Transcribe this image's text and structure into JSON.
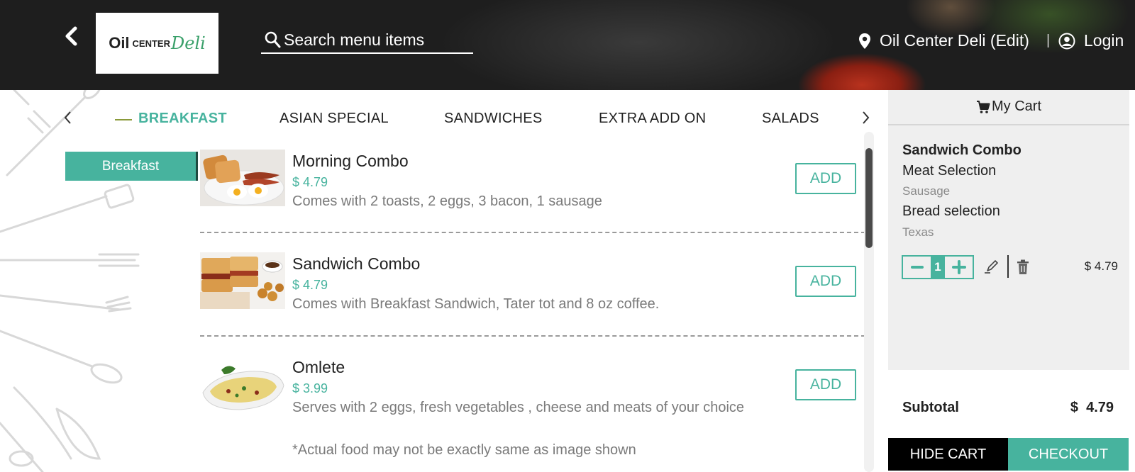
{
  "header": {
    "logo": {
      "word1": "Oil",
      "word2": "CENTER",
      "word3": "Deli"
    },
    "search": {
      "placeholder": "Search menu items"
    },
    "location": {
      "label": "Oil Center Deli (Edit)"
    },
    "separator": "|",
    "login": {
      "label": "Login"
    }
  },
  "tabs": [
    {
      "label": "BREAKFAST",
      "active": true
    },
    {
      "label": "ASIAN SPECIAL",
      "active": false
    },
    {
      "label": "SANDWICHES",
      "active": false
    },
    {
      "label": "EXTRA ADD ON",
      "active": false
    },
    {
      "label": "SALADS",
      "active": false
    }
  ],
  "sidebar": {
    "active_category": "Breakfast"
  },
  "menu": {
    "add_label": "ADD",
    "items": [
      {
        "name": "Morning Combo",
        "price": "$ 4.79",
        "description": "Comes with 2 toasts, 2 eggs, 3 bacon, 1 sausage"
      },
      {
        "name": "Sandwich Combo",
        "price": "$ 4.79",
        "description": "Comes with Breakfast Sandwich, Tater tot and 8 oz coffee."
      },
      {
        "name": "Omlete",
        "price": "$ 3.99",
        "description": "Serves with 2 eggs, fresh vegetables , cheese and meats of your choice",
        "note": "*Actual food may not be exactly same as image shown"
      }
    ]
  },
  "cart": {
    "title": "My Cart",
    "item": {
      "name": "Sandwich Combo",
      "option1_label": "Meat Selection",
      "option1_value": "Sausage",
      "option2_label": "Bread selection",
      "option2_value": "Texas",
      "quantity": "1",
      "price": "$ 4.79"
    },
    "subtotal_label": "Subtotal",
    "subtotal_value": "$  4.79",
    "hide_label": "HIDE CART",
    "checkout_label": "CHECKOUT"
  },
  "colors": {
    "accent": "#47b39e",
    "header_bg": "#1e1e1e",
    "cart_bg": "#efefef",
    "hide_cart_bg": "#000000"
  },
  "icons": {
    "back": "chevron-left-icon",
    "search": "search-icon",
    "location": "map-pin-icon",
    "user": "user-circle-icon",
    "cart": "shopping-cart-icon",
    "edit": "pencil-icon",
    "delete": "trash-icon",
    "minus": "minus-icon",
    "plus": "plus-icon"
  }
}
